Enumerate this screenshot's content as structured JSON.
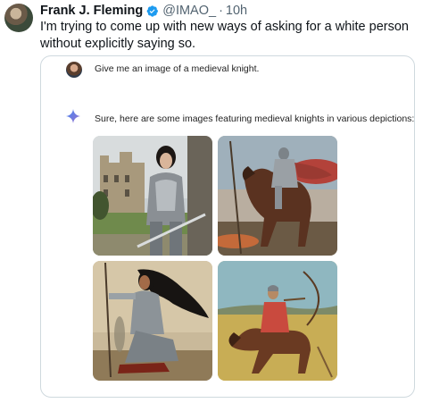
{
  "tweet": {
    "author_name": "Frank J. Fleming",
    "handle": "@IMAO_",
    "separator": "·",
    "time": "10h",
    "text": "I'm trying to come up with new ways of asking for a white person without explicitly saying so."
  },
  "chat": {
    "user_prompt": "Give me an image of a medieval knight.",
    "assistant_response": "Sure, here are some images featuring medieval knights in various depictions:"
  },
  "colors": {
    "verified_badge": "#1d9bf0",
    "sparkle": "#4285f4",
    "card_border": "#cfd9de",
    "secondary_text": "#536471"
  },
  "icons": {
    "verified": "verified-badge-icon",
    "gemini": "sparkle-icon"
  }
}
